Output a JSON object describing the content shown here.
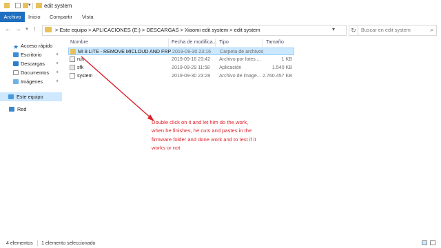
{
  "window": {
    "title": "edit system"
  },
  "ribbon": {
    "tabs": [
      "Archivo",
      "Inicio",
      "Compartir",
      "Vista"
    ]
  },
  "address": {
    "crumbs": [
      "Este equipo",
      "APLICACIONES (E:)",
      "DESCARGAS",
      "Xiaomi edit system",
      "edit system"
    ],
    "separator": ">",
    "search_placeholder": "Buscar en edit system"
  },
  "nav": {
    "items": [
      {
        "label": "Acceso rápido",
        "icon": "star-icon",
        "pinned": false
      },
      {
        "label": "Escritorio",
        "icon": "desktop-icon",
        "pinned": true
      },
      {
        "label": "Descargas",
        "icon": "download-icon",
        "pinned": true
      },
      {
        "label": "Documentos",
        "icon": "documents-icon",
        "pinned": true
      },
      {
        "label": "Imágenes",
        "icon": "pictures-icon",
        "pinned": true
      },
      {
        "label": "Este equipo",
        "icon": "computer-icon",
        "pinned": false,
        "selected": true
      },
      {
        "label": "Red",
        "icon": "network-icon",
        "pinned": false
      }
    ]
  },
  "list": {
    "columns": [
      "Nombre",
      "Fecha de modifica...",
      "Tipo",
      "Tamaño"
    ],
    "rows": [
      {
        "name": "MI 8 LITE - REMOVE MICLOUD AND FRP",
        "date": "2019-09-30 23:16",
        "type": "Carpeta de archivos",
        "size": "",
        "icon": "folder-icon",
        "selected": true
      },
      {
        "name": "run",
        "date": "2019-09-16 23:42",
        "type": "Archivo por lotes ...",
        "size": "1 KB",
        "icon": "batch-file-icon",
        "selected": false
      },
      {
        "name": "sfk",
        "date": "2019-09-29 11:58",
        "type": "Aplicación",
        "size": "1.540 KB",
        "icon": "application-icon",
        "selected": false
      },
      {
        "name": "system",
        "date": "2019-09-30 23:28",
        "type": "Archivo de image...",
        "size": "2.760.457 KB",
        "icon": "disk-image-icon",
        "selected": false
      }
    ]
  },
  "annotation": {
    "text": "Double click on it and let him do the work, when he finishes, he cuts and pastes in the firmware folder and done work and to test if it works or not",
    "color": "#e0202a"
  },
  "status": {
    "count": "4 elementos",
    "selection": "1 elemento seleccionado"
  },
  "colors": {
    "accent": "#1e6fbf",
    "selection": "#cce8ff",
    "folder": "#e8c15a"
  }
}
